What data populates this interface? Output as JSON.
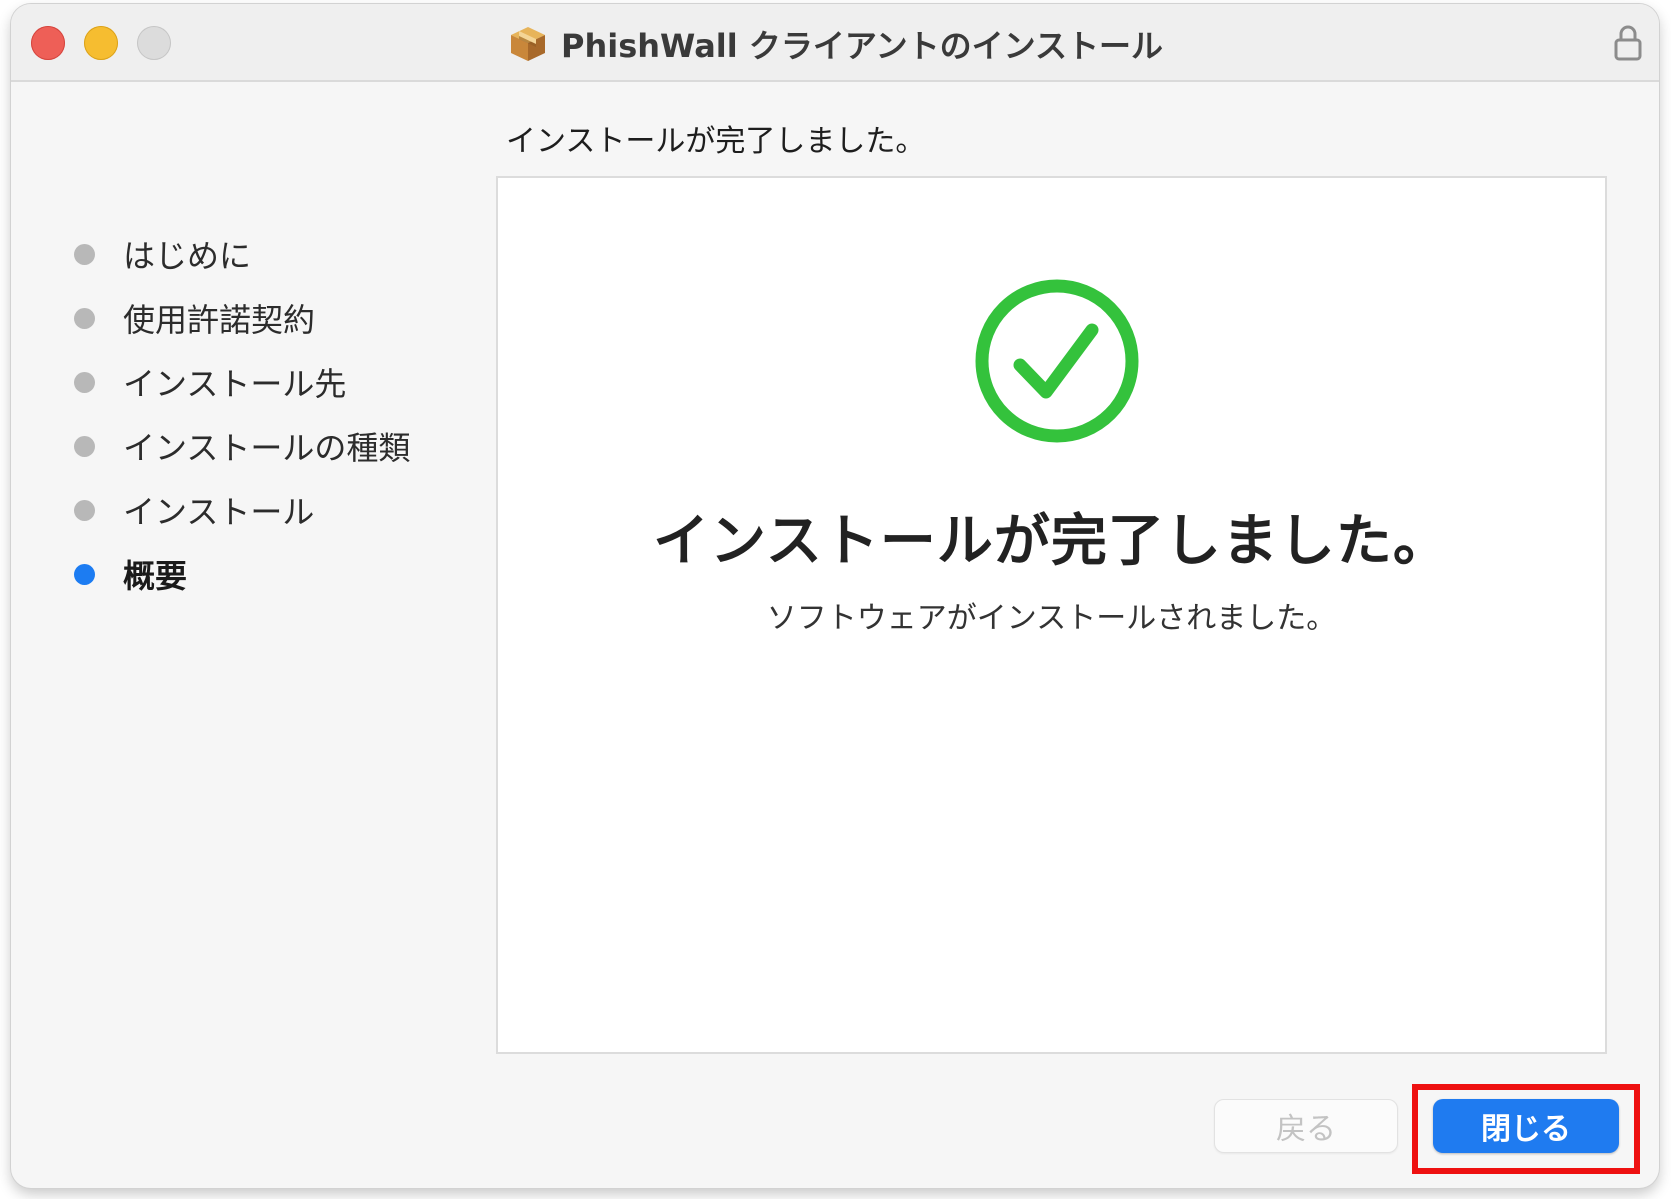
{
  "window": {
    "title": "PhishWall クライアントのインストール",
    "title_icon": "package-icon",
    "lock_icon": "lock-icon"
  },
  "heading": "インストールが完了しました。",
  "sidebar": {
    "items": [
      {
        "label": "はじめに",
        "active": false
      },
      {
        "label": "使用許諾契約",
        "active": false
      },
      {
        "label": "インストール先",
        "active": false
      },
      {
        "label": "インストールの種類",
        "active": false
      },
      {
        "label": "インストール",
        "active": false
      },
      {
        "label": "概要",
        "active": true
      }
    ]
  },
  "content": {
    "icon": "checkmark-circle-icon",
    "title": "インストールが完了しました。",
    "subtitle": "ソフトウェアがインストールされました。"
  },
  "buttons": {
    "back": {
      "label": "戻る",
      "enabled": false
    },
    "close": {
      "label": "閉じる",
      "enabled": true
    }
  },
  "colors": {
    "accent": "#1f7bf0",
    "success": "#34c23c",
    "highlight": "#ee1111",
    "inactive_dot": "#b8b8b8"
  }
}
